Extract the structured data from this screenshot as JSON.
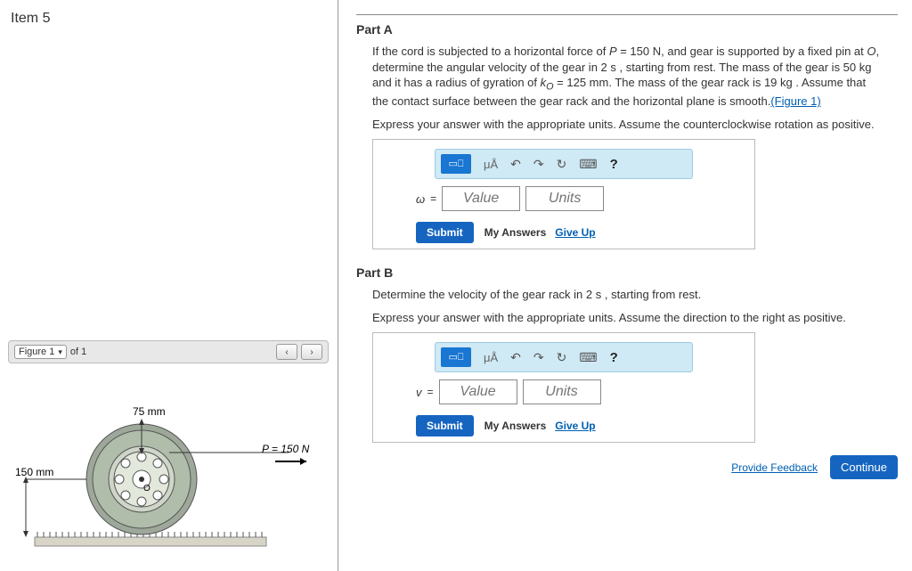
{
  "item": {
    "title": "Item 5"
  },
  "figure": {
    "select_label": "Figure 1",
    "of_text": "of 1",
    "label_75": "75 mm",
    "label_150": "150 mm",
    "label_P": "P = 150 N"
  },
  "partA": {
    "heading": "Part A",
    "prompt_html": "If the cord is subjected to a horizontal force of P = 150 N, and gear is supported by a fixed pin at O, determine the angular velocity of the gear in 2 s , starting from rest. The mass of the gear is 50 kg and it has a radius of gyration of k_O = 125 mm. The mass of the gear rack is 19 kg . Assume that the contact surface between the gear rack and the horizontal plane is smooth.",
    "figure_link": "(Figure 1)",
    "instruct": "Express your answer with the appropriate units. Assume the counterclockwise rotation as positive.",
    "var": "ω",
    "value_ph": "Value",
    "units_ph": "Units",
    "submit": "Submit",
    "my_answers": "My Answers",
    "give_up": "Give Up"
  },
  "partB": {
    "heading": "Part B",
    "prompt": "Determine the velocity of the gear rack in 2 s , starting from rest.",
    "instruct": "Express your answer with the appropriate units. Assume the direction to the right as positive.",
    "var": "v",
    "value_ph": "Value",
    "units_ph": "Units",
    "submit": "Submit",
    "my_answers": "My Answers",
    "give_up": "Give Up"
  },
  "toolbar": {
    "mu": "μÅ",
    "help": "?"
  },
  "footer": {
    "feedback": "Provide Feedback",
    "continue": "Continue"
  }
}
